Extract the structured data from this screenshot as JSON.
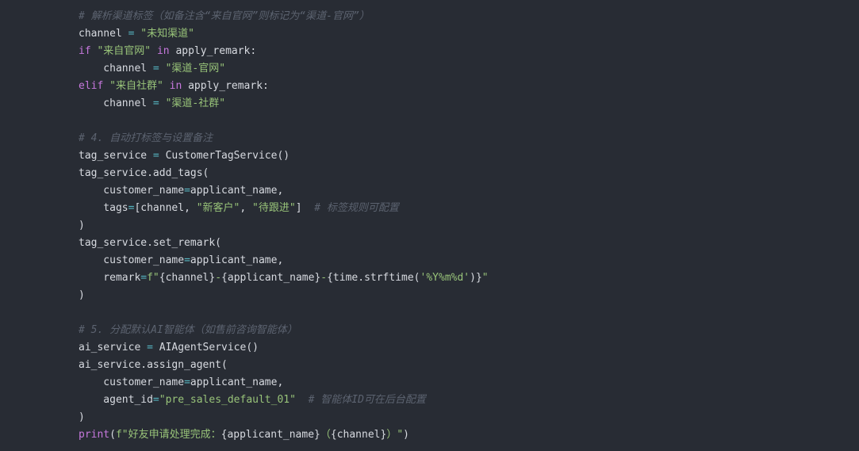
{
  "colors": {
    "background": "#282c34",
    "plain": "#d7dae0",
    "comment": "#5c6370",
    "keyword": "#c678dd",
    "string": "#98c379",
    "operator": "#56b6c2"
  },
  "lines": [
    [
      {
        "t": "comment",
        "v": "# 解析渠道标签（如备注含“来自官网”则标记为“渠道-官网”）"
      }
    ],
    [
      {
        "t": "plain",
        "v": "channel "
      },
      {
        "t": "op",
        "v": "="
      },
      {
        "t": "plain",
        "v": " "
      },
      {
        "t": "string",
        "v": "\"未知渠道\""
      }
    ],
    [
      {
        "t": "keyword",
        "v": "if"
      },
      {
        "t": "plain",
        "v": " "
      },
      {
        "t": "string",
        "v": "\"来自官网\""
      },
      {
        "t": "plain",
        "v": " "
      },
      {
        "t": "keyword",
        "v": "in"
      },
      {
        "t": "plain",
        "v": " apply_remark:"
      }
    ],
    [
      {
        "t": "plain",
        "v": "    channel "
      },
      {
        "t": "op",
        "v": "="
      },
      {
        "t": "plain",
        "v": " "
      },
      {
        "t": "string",
        "v": "\"渠道-官网\""
      }
    ],
    [
      {
        "t": "keyword",
        "v": "elif"
      },
      {
        "t": "plain",
        "v": " "
      },
      {
        "t": "string",
        "v": "\"来自社群\""
      },
      {
        "t": "plain",
        "v": " "
      },
      {
        "t": "keyword",
        "v": "in"
      },
      {
        "t": "plain",
        "v": " apply_remark:"
      }
    ],
    [
      {
        "t": "plain",
        "v": "    channel "
      },
      {
        "t": "op",
        "v": "="
      },
      {
        "t": "plain",
        "v": " "
      },
      {
        "t": "string",
        "v": "\"渠道-社群\""
      }
    ],
    [],
    [
      {
        "t": "comment",
        "v": "# 4. 自动打标签与设置备注"
      }
    ],
    [
      {
        "t": "plain",
        "v": "tag_service "
      },
      {
        "t": "op",
        "v": "="
      },
      {
        "t": "plain",
        "v": " CustomerTagService()"
      }
    ],
    [
      {
        "t": "plain",
        "v": "tag_service.add_tags("
      }
    ],
    [
      {
        "t": "plain",
        "v": "    customer_name"
      },
      {
        "t": "op",
        "v": "="
      },
      {
        "t": "plain",
        "v": "applicant_name,"
      }
    ],
    [
      {
        "t": "plain",
        "v": "    tags"
      },
      {
        "t": "op",
        "v": "="
      },
      {
        "t": "plain",
        "v": "[channel, "
      },
      {
        "t": "string",
        "v": "\"新客户\""
      },
      {
        "t": "plain",
        "v": ", "
      },
      {
        "t": "string",
        "v": "\"待跟进\""
      },
      {
        "t": "plain",
        "v": "]  "
      },
      {
        "t": "comment",
        "v": "# 标签规则可配置"
      }
    ],
    [
      {
        "t": "plain",
        "v": ")"
      }
    ],
    [
      {
        "t": "plain",
        "v": "tag_service.set_remark("
      }
    ],
    [
      {
        "t": "plain",
        "v": "    customer_name"
      },
      {
        "t": "op",
        "v": "="
      },
      {
        "t": "plain",
        "v": "applicant_name,"
      }
    ],
    [
      {
        "t": "plain",
        "v": "    remark"
      },
      {
        "t": "op",
        "v": "="
      },
      {
        "t": "string",
        "v": "f\""
      },
      {
        "t": "plain",
        "v": "{channel}"
      },
      {
        "t": "string",
        "v": "-"
      },
      {
        "t": "plain",
        "v": "{applicant_name}"
      },
      {
        "t": "string",
        "v": "-"
      },
      {
        "t": "plain",
        "v": "{time.strftime("
      },
      {
        "t": "string",
        "v": "'%Y%m%d'"
      },
      {
        "t": "plain",
        "v": ")}"
      },
      {
        "t": "string",
        "v": "\""
      }
    ],
    [
      {
        "t": "plain",
        "v": ")"
      }
    ],
    [],
    [
      {
        "t": "comment",
        "v": "# 5. 分配默认AI智能体（如售前咨询智能体）"
      }
    ],
    [
      {
        "t": "plain",
        "v": "ai_service "
      },
      {
        "t": "op",
        "v": "="
      },
      {
        "t": "plain",
        "v": " AIAgentService()"
      }
    ],
    [
      {
        "t": "plain",
        "v": "ai_service.assign_agent("
      }
    ],
    [
      {
        "t": "plain",
        "v": "    customer_name"
      },
      {
        "t": "op",
        "v": "="
      },
      {
        "t": "plain",
        "v": "applicant_name,"
      }
    ],
    [
      {
        "t": "plain",
        "v": "    agent_id"
      },
      {
        "t": "op",
        "v": "="
      },
      {
        "t": "string",
        "v": "\"pre_sales_default_01\""
      },
      {
        "t": "plain",
        "v": "  "
      },
      {
        "t": "comment",
        "v": "# 智能体ID可在后台配置"
      }
    ],
    [
      {
        "t": "plain",
        "v": ")"
      }
    ],
    [
      {
        "t": "keyword",
        "v": "print"
      },
      {
        "t": "plain",
        "v": "("
      },
      {
        "t": "string",
        "v": "f\"好友申请处理完成："
      },
      {
        "t": "plain",
        "v": "{applicant_name}"
      },
      {
        "t": "string",
        "v": "（"
      },
      {
        "t": "plain",
        "v": "{channel}"
      },
      {
        "t": "string",
        "v": "）\""
      },
      {
        "t": "plain",
        "v": ")"
      }
    ]
  ]
}
